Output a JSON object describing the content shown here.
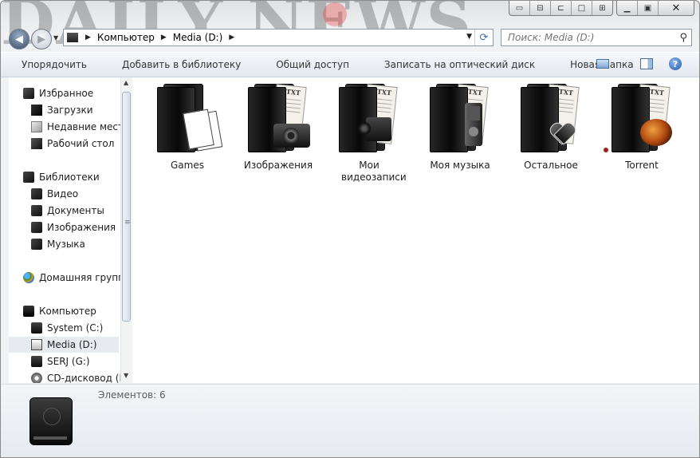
{
  "background_text": "DAILY NEWS",
  "address": {
    "segments": [
      "Компьютер",
      "Media (D:)"
    ]
  },
  "search": {
    "placeholder": "Поиск: Media (D:)"
  },
  "toolbar": {
    "organize": "Упорядочить",
    "add_library": "Добавить в библиотеку",
    "share": "Общий доступ",
    "burn": "Записать на оптический диск",
    "new_folder": "Новая папка"
  },
  "sidebar": {
    "favorites": "Избранное",
    "downloads": "Загрузки",
    "recent": "Недавние места",
    "desktop": "Рабочий стол",
    "libraries": "Библиотеки",
    "video": "Видео",
    "documents": "Документы",
    "images": "Изображения",
    "music": "Музыка",
    "homegroup": "Домашняя группа",
    "computer": "Компьютер",
    "system": "System (C:)",
    "media": "Media (D:)",
    "serj": "SERJ (G:)",
    "cd": "CD-дисковод (H"
  },
  "files": [
    {
      "label": "Games"
    },
    {
      "label": "Изображения"
    },
    {
      "label": "Мои видеозаписи"
    },
    {
      "label": "Моя музыка"
    },
    {
      "label": "Остальное"
    },
    {
      "label": "Torrent"
    }
  ],
  "paper_text": "TXT",
  "status": {
    "count": "Элементов: 6"
  },
  "colors": {
    "window_chrome": "#eceef0",
    "selection": "#e7eaef",
    "status_text": "#5a5a5a"
  }
}
